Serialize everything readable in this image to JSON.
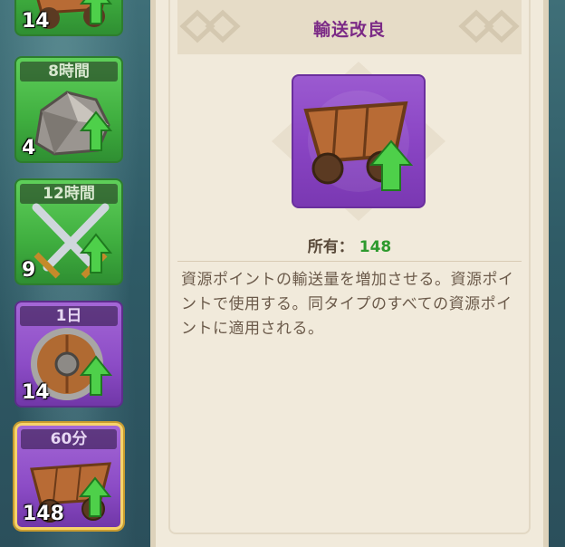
{
  "items": [
    {
      "timer": "",
      "count": "14",
      "type": "cart",
      "color": "green"
    },
    {
      "timer": "8時間",
      "count": "4",
      "type": "stone",
      "color": "green"
    },
    {
      "timer": "12時間",
      "count": "9",
      "type": "swords",
      "color": "green"
    },
    {
      "timer": "1日",
      "count": "14",
      "type": "shield",
      "color": "purple"
    },
    {
      "timer": "60分",
      "count": "148",
      "type": "cart",
      "color": "purple",
      "selected": true
    }
  ],
  "detail": {
    "title": "輸送改良",
    "owned_label": "所有：",
    "owned_value": "148",
    "description": "資源ポイントの輸送量を増加させる。資源ポイントで使用する。同タイプのすべての資源ポイントに適用される。"
  },
  "colors": {
    "title": "#7b2a86",
    "owned_value": "#2e9a2e",
    "green_card": "#3fae3f",
    "purple_card": "#8c4cc6",
    "selected_border": "#f7d36a"
  }
}
